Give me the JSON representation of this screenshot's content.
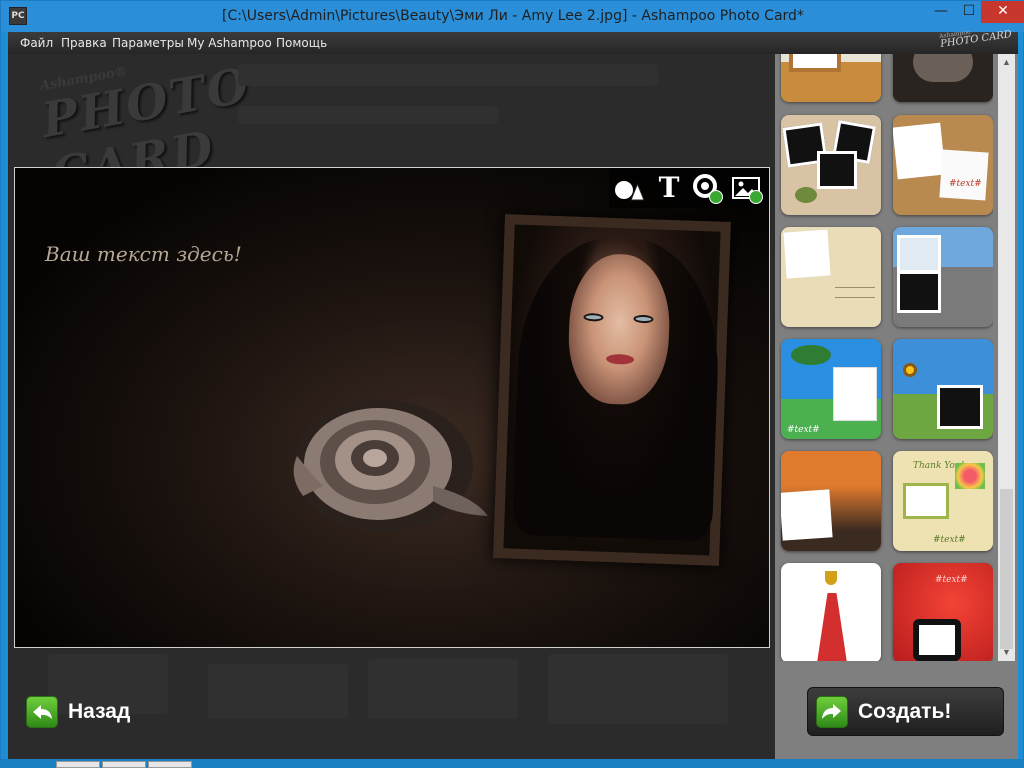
{
  "window": {
    "title": "[C:\\Users\\Admin\\Pictures\\Beauty\\Эми Ли - Amy Lee 2.jpg] - Ashampoo Photo Card*",
    "app_icon_text": "PC",
    "minimize": "—",
    "maximize": "☐",
    "close": "✕"
  },
  "menu": {
    "items": [
      "Файл",
      "Правка",
      "Параметры",
      "My Ashampoo",
      "Помощь"
    ],
    "logo_brand": "Ashampoo",
    "logo_product": "PHOTO CARD"
  },
  "main": {
    "bg_logo_brand": "Ashampoo®",
    "bg_logo_product": "PHOTO CARD",
    "card_text": "Ваш текст здесь!",
    "tools": [
      "shapes-icon",
      "text-icon",
      "style-icon",
      "background-icon"
    ],
    "tool_text_glyph": "T",
    "back_label": "Назад"
  },
  "sidebar": {
    "thumb_labels": {
      "cork": "#text#",
      "palm": "#text#",
      "thankyou_title": "Thank You!",
      "thankyou_text": "#text#",
      "red": "#text#"
    },
    "create_label": "Создать!"
  },
  "colors": {
    "accent_green": "#3aa832",
    "titlebar": "#2a8fd8",
    "close_red": "#c8372e"
  }
}
